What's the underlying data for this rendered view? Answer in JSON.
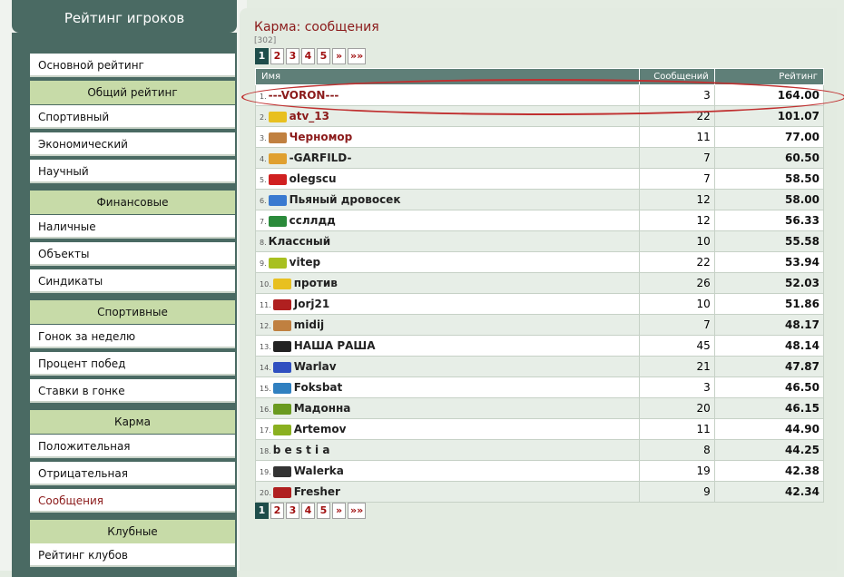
{
  "sidebar": {
    "title": "Рейтинг игроков",
    "items": [
      {
        "type": "item",
        "label": "Основной рейтинг"
      },
      {
        "type": "head",
        "label": "Общий рейтинг"
      },
      {
        "type": "item",
        "label": "Спортивный"
      },
      {
        "type": "item",
        "label": "Экономический"
      },
      {
        "type": "item",
        "label": "Научный"
      },
      {
        "type": "head",
        "label": "Финансовые"
      },
      {
        "type": "item",
        "label": "Наличные"
      },
      {
        "type": "item",
        "label": "Объекты"
      },
      {
        "type": "item",
        "label": "Синдикаты"
      },
      {
        "type": "head",
        "label": "Спортивные"
      },
      {
        "type": "item",
        "label": "Гонок за неделю"
      },
      {
        "type": "item",
        "label": "Процент побед"
      },
      {
        "type": "item",
        "label": "Ставки в гонке"
      },
      {
        "type": "head",
        "label": "Карма"
      },
      {
        "type": "item",
        "label": "Положительная"
      },
      {
        "type": "item",
        "label": "Отрицательная"
      },
      {
        "type": "item",
        "label": "Сообщения",
        "active": true
      },
      {
        "type": "head",
        "label": "Клубные"
      },
      {
        "type": "item",
        "label": "Рейтинг клубов"
      }
    ]
  },
  "main": {
    "title": "Карма: сообщения",
    "total": "[302]",
    "pager": [
      "1",
      "2",
      "3",
      "4",
      "5",
      "»",
      "»»"
    ],
    "columns": {
      "name": "Имя",
      "messages": "Сообщений",
      "rating": "Рейтинг"
    },
    "rows": [
      {
        "rank": "1.",
        "name": "---VORON---",
        "messages": "3",
        "rating": "164.00",
        "red": true,
        "icon": "none",
        "color": "#ffffff"
      },
      {
        "rank": "2.",
        "name": "atv_13",
        "messages": "22",
        "rating": "101.07",
        "red": true,
        "icon": "eye-icon",
        "color": "#e8c020"
      },
      {
        "rank": "3.",
        "name": "Черномор",
        "messages": "11",
        "rating": "77.00",
        "red": true,
        "icon": "animal-icon",
        "color": "#c08040"
      },
      {
        "rank": "4.",
        "name": "-GARFILD-",
        "messages": "7",
        "rating": "60.50",
        "red": false,
        "icon": "face-icon",
        "color": "#e0a030"
      },
      {
        "rank": "5.",
        "name": "olegscu",
        "messages": "7",
        "rating": "58.50",
        "red": false,
        "icon": "flag-icon",
        "color": "#d02020"
      },
      {
        "rank": "6.",
        "name": "Пьяный дровосек",
        "messages": "12",
        "rating": "58.00",
        "red": false,
        "icon": "flag-icon",
        "color": "#3a7ad0"
      },
      {
        "rank": "7.",
        "name": "ссллдд",
        "messages": "12",
        "rating": "56.33",
        "red": false,
        "icon": "flag-icon",
        "color": "#2a8a3a"
      },
      {
        "rank": "8.",
        "name": "Классный",
        "messages": "10",
        "rating": "55.58",
        "red": false,
        "icon": "none",
        "color": "#ffffff"
      },
      {
        "rank": "9.",
        "name": "vitep",
        "messages": "22",
        "rating": "53.94",
        "red": false,
        "icon": "badge-icon",
        "color": "#a8c020"
      },
      {
        "rank": "10.",
        "name": "против",
        "messages": "26",
        "rating": "52.03",
        "red": false,
        "icon": "eye-icon",
        "color": "#e8c020"
      },
      {
        "rank": "11.",
        "name": "Jorj21",
        "messages": "10",
        "rating": "51.86",
        "red": false,
        "icon": "badge-icon",
        "color": "#b02020"
      },
      {
        "rank": "12.",
        "name": "midij",
        "messages": "7",
        "rating": "48.17",
        "red": false,
        "icon": "animal-icon",
        "color": "#c08040"
      },
      {
        "rank": "13.",
        "name": "НАША РАША",
        "messages": "45",
        "rating": "48.14",
        "red": false,
        "icon": "logo-icon",
        "color": "#222222"
      },
      {
        "rank": "14.",
        "name": "Warlav",
        "messages": "21",
        "rating": "47.87",
        "red": false,
        "icon": "flag-icon",
        "color": "#3050c0"
      },
      {
        "rank": "15.",
        "name": "Foksbat",
        "messages": "3",
        "rating": "46.50",
        "red": false,
        "icon": "logo-icon",
        "color": "#3080c0"
      },
      {
        "rank": "16.",
        "name": "Мадонна",
        "messages": "20",
        "rating": "46.15",
        "red": false,
        "icon": "hazard-icon",
        "color": "#6a9a20"
      },
      {
        "rank": "17.",
        "name": "Artemov",
        "messages": "11",
        "rating": "44.90",
        "red": false,
        "icon": "badge-icon",
        "color": "#8ab020"
      },
      {
        "rank": "18.",
        "name": "b e s t i a",
        "messages": "8",
        "rating": "44.25",
        "red": false,
        "icon": "none",
        "color": "#ffffff"
      },
      {
        "rank": "19.",
        "name": "Walerka",
        "messages": "19",
        "rating": "42.38",
        "red": false,
        "icon": "logo-icon",
        "color": "#333333"
      },
      {
        "rank": "20.",
        "name": "Fresher",
        "messages": "9",
        "rating": "42.34",
        "red": false,
        "icon": "badge-icon",
        "color": "#b02020"
      }
    ]
  }
}
